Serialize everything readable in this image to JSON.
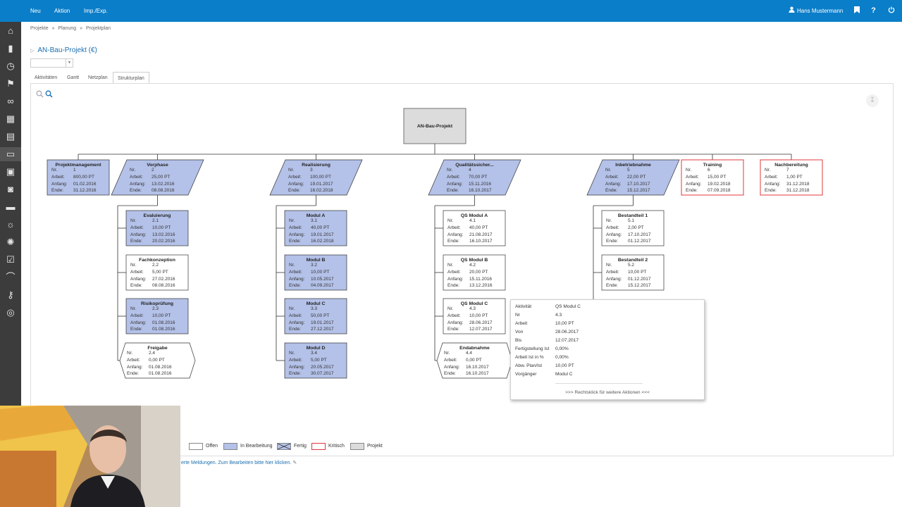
{
  "topbar": {
    "menu": [
      "Neu",
      "Aktion",
      "Imp./Exp."
    ],
    "user": "Hans Mustermann",
    "icons": [
      "bookmark-icon",
      "help-icon",
      "power-icon"
    ]
  },
  "sidebar": {
    "icons": [
      "home-icon",
      "bookmark-icon",
      "stopwatch-icon",
      "flag-icon",
      "link-icon",
      "calculator-icon",
      "calendar-icon",
      "folder-icon",
      "briefcase-icon",
      "camera-icon",
      "card-icon",
      "bulb-icon",
      "gear-icon",
      "checklist-icon",
      "paperclip-icon",
      "key-icon",
      "lifebuoy-icon"
    ]
  },
  "breadcrumb": [
    "Projekte",
    "»",
    "Planung",
    "»",
    "Projektplan"
  ],
  "page": {
    "title": "AN-Bau-Projekt (€)"
  },
  "tabs": [
    "Aktivitäten",
    "Gantt",
    "Netzplan",
    "Strukturplan"
  ],
  "labels": {
    "nr": "Nr.",
    "arbeit": "Arbeit:",
    "anfang": "Anfang:",
    "ende": "Ende:"
  },
  "root": {
    "title": "AN-Bau-Projekt"
  },
  "nodes": [
    {
      "id": "projektmanagement",
      "title": "Projektmanagement",
      "nr": "1",
      "arbeit": "800,00 PT",
      "anfang": "01.02.2016",
      "ende": "31.12.2016",
      "status": "in-bearbeitung"
    },
    {
      "id": "vorphase",
      "title": "Vorphase",
      "nr": "2",
      "arbeit": "25,00 PT",
      "anfang": "13.02.2016",
      "ende": "08.08.2016",
      "status": "in-bearbeitung"
    },
    {
      "id": "realisierung",
      "title": "Realisierung",
      "nr": "3",
      "arbeit": "100,00 PT",
      "anfang": "19.01.2017",
      "ende": "16.02.2018",
      "status": "fertig"
    },
    {
      "id": "qualitaet",
      "title": "Qualitätssicher...",
      "nr": "4",
      "arbeit": "70,00 PT",
      "anfang": "15.11.2016",
      "ende": "16.10.2017",
      "status": "in-bearbeitung"
    },
    {
      "id": "inbetriebnahme",
      "title": "Inbetriebnahme",
      "nr": "5",
      "arbeit": "22,00 PT",
      "anfang": "17.10.2017",
      "ende": "15.12.2017",
      "status": "in-bearbeitung"
    },
    {
      "id": "training",
      "title": "Training",
      "nr": "6",
      "arbeit": "15,00 PT",
      "anfang": "19.02.2018",
      "ende": "07.09.2018",
      "status": "kritisch"
    },
    {
      "id": "nachbereitung",
      "title": "Nachbereitung",
      "nr": "7",
      "arbeit": "1,00 PT",
      "anfang": "31.12.2018",
      "ende": "31.12.2018",
      "status": "kritisch"
    },
    {
      "id": "evaluierung",
      "title": "Evaluierung",
      "nr": "2.1",
      "arbeit": "10,00 PT",
      "anfang": "13.02.2016",
      "ende": "20.02.2016",
      "status": "fertig"
    },
    {
      "id": "fachkonzeption",
      "title": "Fachkonzeption",
      "nr": "2.2",
      "arbeit": "5,00 PT",
      "anfang": "27.02.2016",
      "ende": "08.08.2016",
      "status": "offen"
    },
    {
      "id": "risikopruefung",
      "title": "Risikoprüfung",
      "nr": "2.3",
      "arbeit": "10,00 PT",
      "anfang": "01.08.2016",
      "ende": "01.08.2016",
      "status": "in-bearbeitung"
    },
    {
      "id": "freigabe",
      "title": "Freigabe",
      "nr": "2.4",
      "arbeit": "0,00 PT",
      "anfang": "01.08.2016",
      "ende": "01.08.2016",
      "status": "meilenstein"
    },
    {
      "id": "modula",
      "title": "Modul A",
      "nr": "3.1",
      "arbeit": "40,00 PT",
      "anfang": "19.01.2017",
      "ende": "16.02.2018",
      "status": "fertig"
    },
    {
      "id": "modulb",
      "title": "Modul B",
      "nr": "3.2",
      "arbeit": "10,00 PT",
      "anfang": "10.05.2017",
      "ende": "04.09.2017",
      "status": "fertig"
    },
    {
      "id": "modulc",
      "title": "Modul C",
      "nr": "3.3",
      "arbeit": "50,00 PT",
      "anfang": "19.01.2017",
      "ende": "27.12.2017",
      "status": "fertig"
    },
    {
      "id": "modulD",
      "title": "Modul D",
      "nr": "3.4",
      "arbeit": "5,00 PT",
      "anfang": "20.05.2017",
      "ende": "30.07.2017",
      "status": "fertig"
    },
    {
      "id": "qsa",
      "title": "QS Modul A",
      "nr": "4.1",
      "arbeit": "40,00 PT",
      "anfang": "21.08.2017",
      "ende": "16.10.2017",
      "status": "offen"
    },
    {
      "id": "qsb",
      "title": "QS Modul B",
      "nr": "4.2",
      "arbeit": "20,00 PT",
      "anfang": "15.11.2016",
      "ende": "13.12.2016",
      "status": "offen"
    },
    {
      "id": "qsc",
      "title": "QS Modul C",
      "nr": "4.3",
      "arbeit": "10,00 PT",
      "anfang": "28.06.2017",
      "ende": "12.07.2017",
      "status": "offen"
    },
    {
      "id": "endabnahme",
      "title": "Endabnahme",
      "nr": "4.4",
      "arbeit": "0,00 PT",
      "anfang": "16.10.2017",
      "ende": "16.10.2017",
      "status": "meilenstein"
    },
    {
      "id": "bestandteil1",
      "title": "Bestandteil 1",
      "nr": "5.1",
      "arbeit": "2,00 PT",
      "anfang": "17.10.2017",
      "ende": "01.12.2017",
      "status": "offen"
    },
    {
      "id": "bestandteil2",
      "title": "Bestandteil 2",
      "nr": "5.2",
      "arbeit": "10,00 PT",
      "anfang": "01.12.2017",
      "ende": "15.12.2017",
      "status": "offen"
    }
  ],
  "tooltip": {
    "rows": [
      {
        "k": "Aktivität",
        "v": "QS Modul C"
      },
      {
        "k": "Nr",
        "v": "4.3"
      },
      {
        "k": "Arbeit",
        "v": "10,00 PT"
      },
      {
        "k": "Von",
        "v": "28.06.2017"
      },
      {
        "k": "Bis",
        "v": "12.07.2017"
      },
      {
        "k": "Fertigstellung Ist",
        "v": "0,00%"
      },
      {
        "k": "Arbeit Ist in %",
        "v": "0,00%"
      },
      {
        "k": "Abw. Plan/Ist",
        "v": "10,00 PT"
      },
      {
        "k": "Vorgänger",
        "v": "Modul C"
      }
    ],
    "hint": ">>> Rechtsklick für weitere Aktionen <<<"
  },
  "legend": [
    {
      "label": "n",
      "style": "none"
    },
    {
      "label": "Offen",
      "style": "offen"
    },
    {
      "label": "In Bearbeitung",
      "style": "in-bearbeitung"
    },
    {
      "label": "Fertig",
      "style": "fertig"
    },
    {
      "label": "Kritisch",
      "style": "kritisch"
    },
    {
      "label": "Projekt",
      "style": "projekt"
    }
  ],
  "message": "erte Meldungen. Zum Bearbeiten bitte hier klicken.",
  "colors": {
    "topbar": "#0b7ec9",
    "sidebar": "#3c3c3c",
    "inBearbeitung": "#b4c1e8",
    "kritisch": "#e0383e",
    "projekt": "#dcdcdc",
    "link": "#1a6fb0"
  }
}
